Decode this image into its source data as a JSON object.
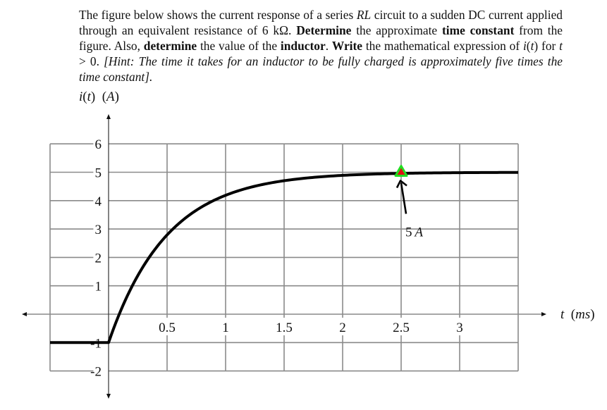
{
  "problem": {
    "segments": [
      {
        "t": "The figure below shows the current response of a series ",
        "s": "n"
      },
      {
        "t": "RL",
        "s": "i"
      },
      {
        "t": " circuit to a sudden DC current applied through an equivalent resistance of 6 kΩ. ",
        "s": "n"
      },
      {
        "t": "Determine",
        "s": "b"
      },
      {
        "t": " the approximate ",
        "s": "n"
      },
      {
        "t": "time constant",
        "s": "b"
      },
      {
        "t": " from the figure.  Also, ",
        "s": "n"
      },
      {
        "t": "determine",
        "s": "b"
      },
      {
        "t": " the value of the ",
        "s": "n"
      },
      {
        "t": "inductor",
        "s": "b"
      },
      {
        "t": ". ",
        "s": "n"
      },
      {
        "t": "Write",
        "s": "b"
      },
      {
        "t": " the mathematical expression of ",
        "s": "n"
      },
      {
        "t": "i",
        "s": "i"
      },
      {
        "t": "(",
        "s": "n"
      },
      {
        "t": "t",
        "s": "i"
      },
      {
        "t": ") for ",
        "s": "n"
      },
      {
        "t": "t",
        "s": "i"
      },
      {
        "t": " > 0. ",
        "s": "n"
      },
      {
        "t": "[Hint: The time it takes for an inductor to be fully charged is approximately five times the time constant].",
        "s": "i"
      }
    ]
  },
  "chart_data": {
    "type": "line",
    "title": "",
    "ylabel": "i(t) (A)",
    "xlabel": "t (ms)",
    "xlim": [
      -0.5,
      3.5
    ],
    "ylim": [
      -2,
      6
    ],
    "grid": true,
    "x_ticks": [
      0.5,
      1,
      1.5,
      2,
      2.5,
      3
    ],
    "x_tick_labels": [
      "0.5",
      "1",
      "1.5",
      "2",
      "2.5",
      "3"
    ],
    "y_ticks": [
      6,
      5,
      4,
      3,
      2,
      1,
      -1,
      -2
    ],
    "y_tick_labels": [
      "6",
      "5",
      "4",
      "3",
      "2",
      "1",
      "-1",
      "-2"
    ],
    "series": [
      {
        "name": "i(t)",
        "description": "i(t) = -1 A for t < 0; i(t) = 5 - 6·e^(-t/0.5ms) for t > 0",
        "initial_value": -1,
        "final_value": 5,
        "time_constant_ms": 0.5,
        "x": [
          -0.5,
          0,
          0.25,
          0.5,
          0.75,
          1.0,
          1.5,
          2.0,
          2.5,
          3.0,
          3.5
        ],
        "y": [
          -1,
          -1,
          1.36,
          2.79,
          3.66,
          4.19,
          4.7,
          4.89,
          4.96,
          4.99,
          5.0
        ]
      }
    ],
    "annotations": [
      {
        "text": "5 A",
        "x": 2.5,
        "y": 5,
        "marker": "triangle",
        "marker_fill": "#e01010",
        "marker_stroke": "#22dd22",
        "arrow": true
      }
    ],
    "colors": {
      "curve": "#000000",
      "grid": "#8a8a8a",
      "axis": "#111111"
    }
  }
}
